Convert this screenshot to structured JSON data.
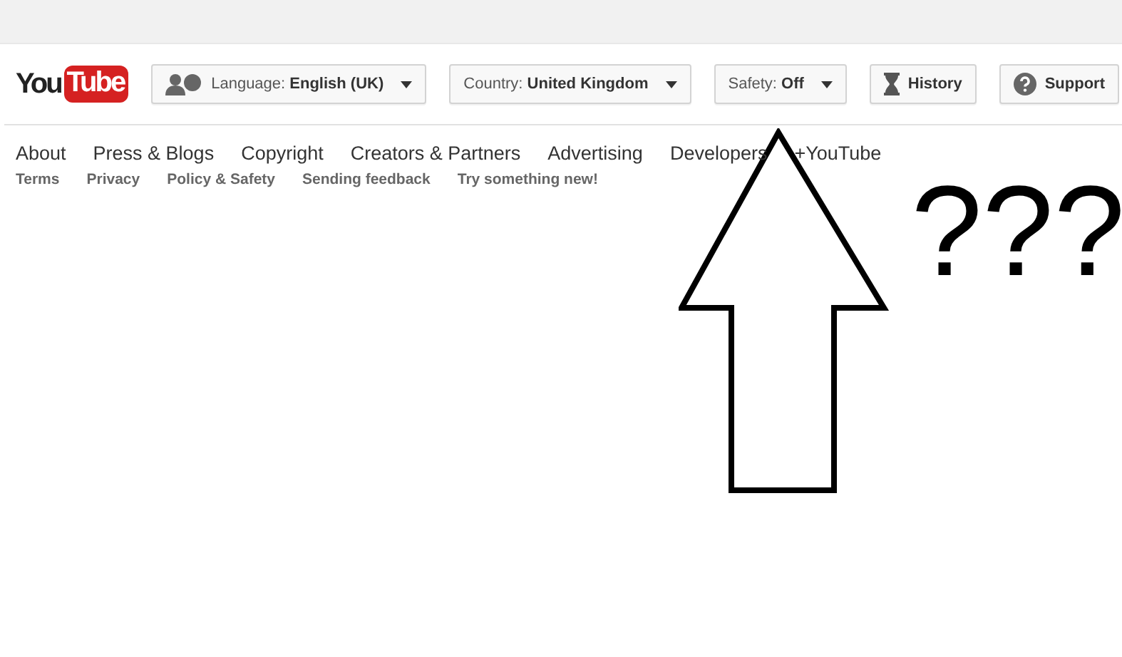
{
  "logo": {
    "left": "You",
    "right": "Tube"
  },
  "toolbar": [
    {
      "kind": "language",
      "label": "Language:",
      "value": "English (UK)"
    },
    {
      "kind": "country",
      "label": "Country:",
      "value": "United Kingdom"
    },
    {
      "kind": "safety",
      "label": "Safety:",
      "value": "Off"
    },
    {
      "kind": "history",
      "value": "History"
    },
    {
      "kind": "support",
      "value": "Support"
    }
  ],
  "primary_links": [
    "About",
    "Press & Blogs",
    "Copyright",
    "Creators & Partners",
    "Advertising",
    "Developers",
    "+YouTube"
  ],
  "secondary_links": [
    "Terms",
    "Privacy",
    "Policy & Safety",
    "Sending feedback",
    "Try something new!"
  ],
  "annotation": {
    "text": "???"
  }
}
